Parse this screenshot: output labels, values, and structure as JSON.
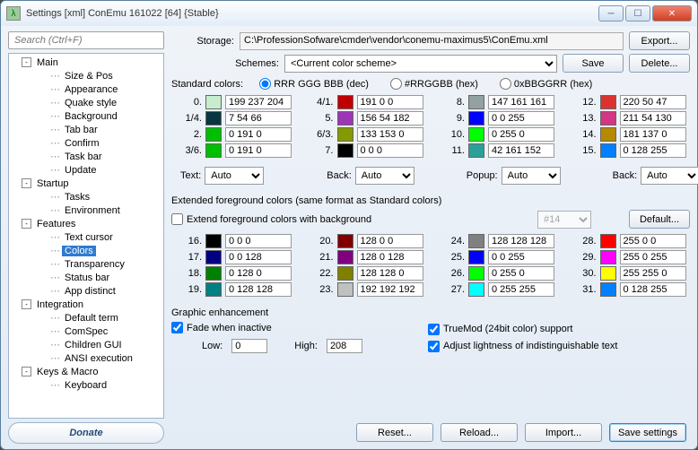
{
  "window": {
    "title": "Settings [xml] ConEmu 161022 [64] {Stable}",
    "icon": "λ"
  },
  "search": {
    "placeholder": "Search (Ctrl+F)"
  },
  "tree": [
    {
      "label": "Main",
      "exp": true,
      "depth": 0
    },
    {
      "label": "Size & Pos",
      "depth": 1,
      "leaf": true
    },
    {
      "label": "Appearance",
      "depth": 1,
      "leaf": true
    },
    {
      "label": "Quake style",
      "depth": 1,
      "leaf": true
    },
    {
      "label": "Background",
      "depth": 1,
      "leaf": true
    },
    {
      "label": "Tab bar",
      "depth": 1,
      "leaf": true
    },
    {
      "label": "Confirm",
      "depth": 1,
      "leaf": true
    },
    {
      "label": "Task bar",
      "depth": 1,
      "leaf": true
    },
    {
      "label": "Update",
      "depth": 1,
      "leaf": true
    },
    {
      "label": "Startup",
      "exp": true,
      "depth": 0
    },
    {
      "label": "Tasks",
      "depth": 1,
      "leaf": true
    },
    {
      "label": "Environment",
      "depth": 1,
      "leaf": true
    },
    {
      "label": "Features",
      "exp": true,
      "depth": 0
    },
    {
      "label": "Text cursor",
      "depth": 1,
      "leaf": true
    },
    {
      "label": "Colors",
      "depth": 1,
      "leaf": true,
      "selected": true
    },
    {
      "label": "Transparency",
      "depth": 1,
      "leaf": true
    },
    {
      "label": "Status bar",
      "depth": 1,
      "leaf": true
    },
    {
      "label": "App distinct",
      "depth": 1,
      "leaf": true
    },
    {
      "label": "Integration",
      "exp": true,
      "depth": 0
    },
    {
      "label": "Default term",
      "depth": 1,
      "leaf": true
    },
    {
      "label": "ComSpec",
      "depth": 1,
      "leaf": true
    },
    {
      "label": "Children GUI",
      "depth": 1,
      "leaf": true
    },
    {
      "label": "ANSI execution",
      "depth": 1,
      "leaf": true
    },
    {
      "label": "Keys & Macro",
      "exp": true,
      "depth": 0
    },
    {
      "label": "Keyboard",
      "depth": 1,
      "leaf": true
    }
  ],
  "donate": "Donate",
  "storage": {
    "label": "Storage:",
    "path": "C:\\ProfessionSofware\\cmder\\vendor\\conemu-maximus5\\ConEmu.xml",
    "export": "Export..."
  },
  "schemes": {
    "label": "Schemes:",
    "value": "<Current color scheme>",
    "save": "Save",
    "delete": "Delete..."
  },
  "std": {
    "label": "Standard colors:",
    "radios": [
      "RRR GGG BBB (dec)",
      "#RRGGBB (hex)",
      "0xBBGGRR (hex)"
    ],
    "radio_sel": 0
  },
  "colors": [
    {
      "n": "0.",
      "c": "#C7EDCC",
      "v": "199 237 204"
    },
    {
      "n": "1/4.",
      "c": "#073642",
      "v": "7 54 66"
    },
    {
      "n": "2.",
      "c": "#00BF00",
      "v": "0 191 0"
    },
    {
      "n": "3/6.",
      "c": "#00BF00",
      "v": "0 191 0"
    },
    {
      "n": "4/1.",
      "c": "#BF0000",
      "v": "191 0 0"
    },
    {
      "n": "5.",
      "c": "#9C36B6",
      "v": "156 54 182"
    },
    {
      "n": "6/3.",
      "c": "#859900",
      "v": "133 153 0"
    },
    {
      "n": "7.",
      "c": "#000000",
      "v": "0 0 0"
    },
    {
      "n": "8.",
      "c": "#93A1A1",
      "v": "147 161 161"
    },
    {
      "n": "9.",
      "c": "#0000FF",
      "v": "0 0 255"
    },
    {
      "n": "10.",
      "c": "#00FF00",
      "v": "0 255 0"
    },
    {
      "n": "11.",
      "c": "#2AA198",
      "v": "42 161 152"
    },
    {
      "n": "12.",
      "c": "#DC322F",
      "v": "220 50 47"
    },
    {
      "n": "13.",
      "c": "#D33682",
      "v": "211 54 130"
    },
    {
      "n": "14.",
      "c": "#B58900",
      "v": "181 137 0"
    },
    {
      "n": "15.",
      "c": "#0080FF",
      "v": "0 128 255"
    }
  ],
  "auto": {
    "text": "Text:",
    "back": "Back:",
    "popup": "Popup:",
    "back2": "Back:",
    "val": "Auto"
  },
  "ext": {
    "label": "Extended foreground colors (same format as Standard colors)",
    "chk": "Extend foreground colors with background",
    "sel": "#14",
    "default": "Default..."
  },
  "extcolors": [
    {
      "n": "16.",
      "c": "#000000",
      "v": "0 0 0"
    },
    {
      "n": "17.",
      "c": "#000080",
      "v": "0 0 128"
    },
    {
      "n": "18.",
      "c": "#008000",
      "v": "0 128 0"
    },
    {
      "n": "19.",
      "c": "#008080",
      "v": "0 128 128"
    },
    {
      "n": "20.",
      "c": "#800000",
      "v": "128 0 0"
    },
    {
      "n": "21.",
      "c": "#800080",
      "v": "128 0 128"
    },
    {
      "n": "22.",
      "c": "#808000",
      "v": "128 128 0"
    },
    {
      "n": "23.",
      "c": "#C0C0C0",
      "v": "192 192 192"
    },
    {
      "n": "24.",
      "c": "#808080",
      "v": "128 128 128"
    },
    {
      "n": "25.",
      "c": "#0000FF",
      "v": "0 0 255"
    },
    {
      "n": "26.",
      "c": "#00FF00",
      "v": "0 255 0"
    },
    {
      "n": "27.",
      "c": "#00FFFF",
      "v": "0 255 255"
    },
    {
      "n": "28.",
      "c": "#FF0000",
      "v": "255 0 0"
    },
    {
      "n": "29.",
      "c": "#FF00FF",
      "v": "255 0 255"
    },
    {
      "n": "30.",
      "c": "#FFFF00",
      "v": "255 255 0"
    },
    {
      "n": "31.",
      "c": "#0080FF",
      "v": "0 128 255"
    }
  ],
  "gfx": {
    "label": "Graphic enhancement",
    "fade": "Fade when inactive",
    "low_l": "Low:",
    "low": "0",
    "high_l": "High:",
    "high": "208",
    "truemod": "TrueMod (24bit color) support",
    "adjust": "Adjust lightness of indistinguishable text"
  },
  "foot": {
    "reset": "Reset...",
    "reload": "Reload...",
    "import": "Import...",
    "save": "Save settings"
  }
}
